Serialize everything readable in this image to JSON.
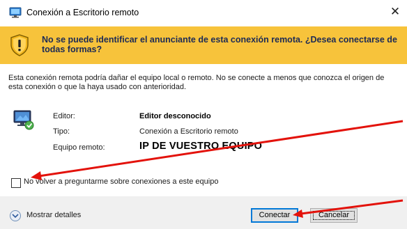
{
  "window": {
    "title": "Conexión a Escritorio remoto",
    "close_glyph": "✕"
  },
  "banner": {
    "message": "No se puede identificar el anunciante de esta conexión remota. ¿Desea conectarse de todas formas?",
    "icon": "shield-warning-icon",
    "color": "#f7c33b"
  },
  "body": {
    "warning": "Esta conexión remota podría dañar el equipo local o remoto. No se conecte a menos que conozca el origen de esta conexión o que la haya usado con anterioridad.",
    "icon": "computer-icon",
    "details": [
      {
        "label": "Editor:",
        "value": "Editor desconocido"
      },
      {
        "label": "Tipo:",
        "value": "Conexión a Escritorio remoto"
      },
      {
        "label": "Equipo remoto:",
        "value": "IP DE VUESTRO EQUIPO"
      }
    ]
  },
  "checkbox": {
    "label": "No volver a preguntarme sobre conexiones a este equipo",
    "checked": false
  },
  "footer": {
    "details_toggle": "Mostrar detalles",
    "connect_label": "Conectar",
    "cancel_label": "Cancelar"
  },
  "annotations": {
    "arrow_color": "#e3120b"
  }
}
